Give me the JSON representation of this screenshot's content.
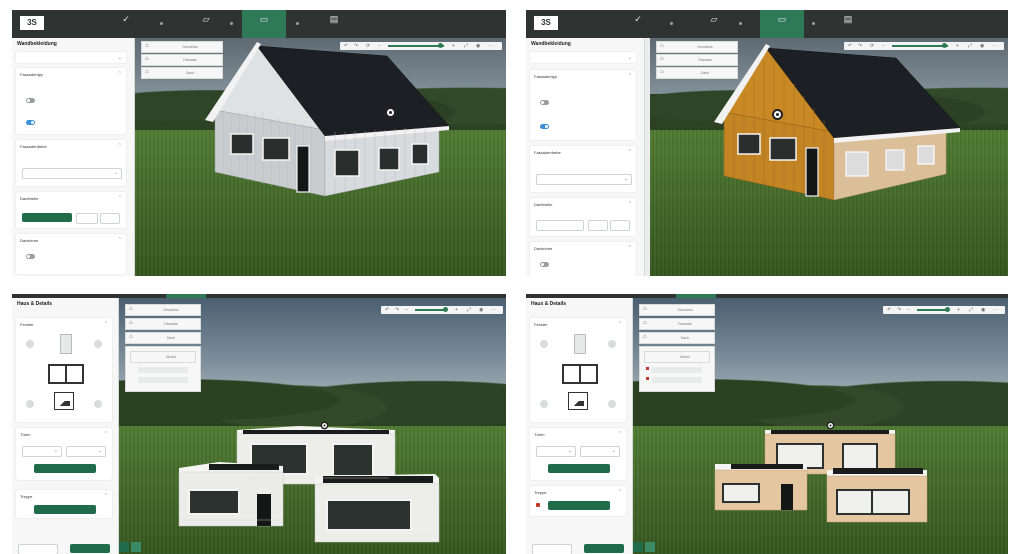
{
  "colors": {
    "topbar": "#2f3433",
    "accent": "#2e7a56",
    "button": "#1f6b4a",
    "toggle_on": "#3a8fd6",
    "grass": "#4f7a32"
  },
  "icons": {
    "logo": "3S",
    "nav1": "✓",
    "nav2": "▱",
    "nav3": "▭",
    "nav4": "▤"
  },
  "panels": [
    {
      "id": "tl",
      "walls": "#d3d6d8",
      "gable": "#d3d6d8",
      "sidebar": {
        "title": "Wandbekleidung",
        "cards": [
          "Fassadentyp",
          "Fassadenfarbe",
          "Dachfarbe",
          "Dachrinne"
        ]
      },
      "tiles": [
        "Grundriss",
        "Fassade",
        "Dach"
      ]
    },
    {
      "id": "tr",
      "walls": "#d9bc94",
      "gable": "#c9861e",
      "sidebar": {
        "title": "Wandbekleidung",
        "cards": [
          "Fassadentyp",
          "Fassadenfarbe",
          "Dachfarbe",
          "Dachrinne"
        ]
      },
      "tiles": [
        "Grundriss",
        "Fassade",
        "Dach"
      ]
    },
    {
      "id": "bl",
      "walls": "#efefec",
      "sidebar": {
        "title": "Haus & Details",
        "cards": [
          "Fenster",
          "Türen",
          "Treppe"
        ]
      },
      "tiles": [
        "Grundriss",
        "Fassade",
        "Dach",
        "Modul"
      ]
    },
    {
      "id": "br",
      "walls": "#e6c9a4",
      "sidebar": {
        "title": "Haus & Details",
        "cards": [
          "Fenster",
          "Türen",
          "Treppe"
        ]
      },
      "tiles": [
        "Grundriss",
        "Fassade",
        "Dach",
        "Modul"
      ]
    }
  ]
}
